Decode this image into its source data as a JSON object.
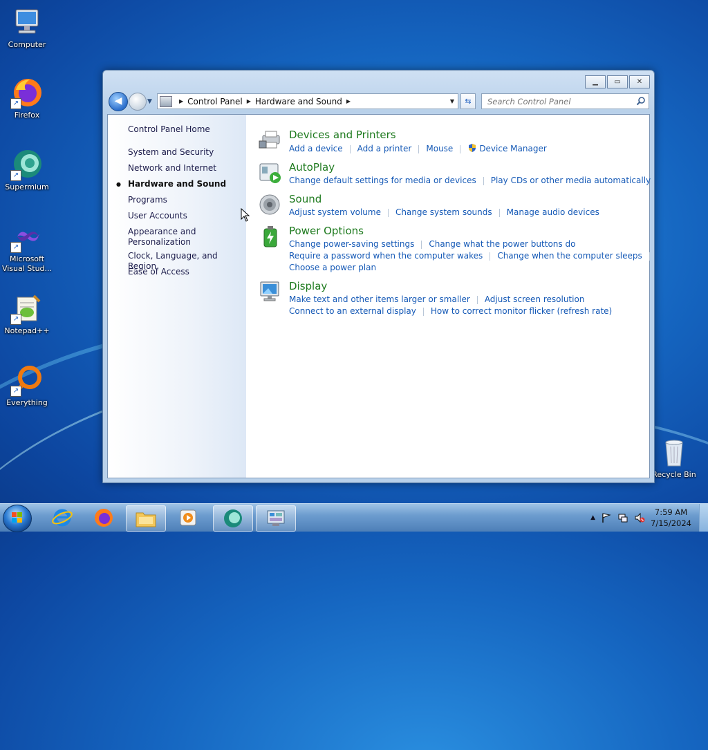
{
  "desktop": {
    "icons": [
      {
        "label": "Computer"
      },
      {
        "label": "Firefox"
      },
      {
        "label": "Supermium"
      },
      {
        "label": "Microsoft Visual Stud..."
      },
      {
        "label": "Notepad++"
      },
      {
        "label": "Everything"
      },
      {
        "label": "Recycle Bin"
      }
    ]
  },
  "window": {
    "address": {
      "crumbs": [
        "Control Panel",
        "Hardware and Sound"
      ]
    },
    "search": {
      "placeholder": "Search Control Panel"
    },
    "left_nav": {
      "home": "Control Panel Home",
      "items": [
        {
          "label": "System and Security"
        },
        {
          "label": "Network and Internet"
        },
        {
          "label": "Hardware and Sound",
          "active": true
        },
        {
          "label": "Programs"
        },
        {
          "label": "User Accounts"
        },
        {
          "label": "Appearance and Personalization"
        },
        {
          "label": "Clock, Language, and Region"
        },
        {
          "label": "Ease of Access"
        }
      ]
    },
    "categories": [
      {
        "title": "Devices and Printers",
        "icon": "printer-icon",
        "link_rows": [
          [
            "Add a device",
            "Add a printer",
            "Mouse",
            "Device Manager"
          ]
        ]
      },
      {
        "title": "AutoPlay",
        "icon": "autoplay-icon",
        "link_rows": [
          [
            "Change default settings for media or devices",
            "Play CDs or other media automatically"
          ]
        ]
      },
      {
        "title": "Sound",
        "icon": "speaker-icon",
        "link_rows": [
          [
            "Adjust system volume",
            "Change system sounds",
            "Manage audio devices"
          ]
        ]
      },
      {
        "title": "Power Options",
        "icon": "battery-icon",
        "link_rows": [
          [
            "Change power-saving settings",
            "Change what the power buttons do"
          ],
          [
            "Require a password when the computer wakes",
            "Change when the computer sleeps"
          ],
          [
            "Choose a power plan"
          ]
        ]
      },
      {
        "title": "Display",
        "icon": "monitor-icon",
        "link_rows": [
          [
            "Make text and other items larger or smaller",
            "Adjust screen resolution"
          ],
          [
            "Connect to an external display",
            "How to correct monitor flicker (refresh rate)"
          ]
        ]
      }
    ]
  },
  "taskbar": {
    "clock": {
      "time": "7:59 AM",
      "date": "7/15/2024"
    }
  },
  "colors": {
    "title_green": "#1e7a1e",
    "link_blue": "#1559b6"
  }
}
